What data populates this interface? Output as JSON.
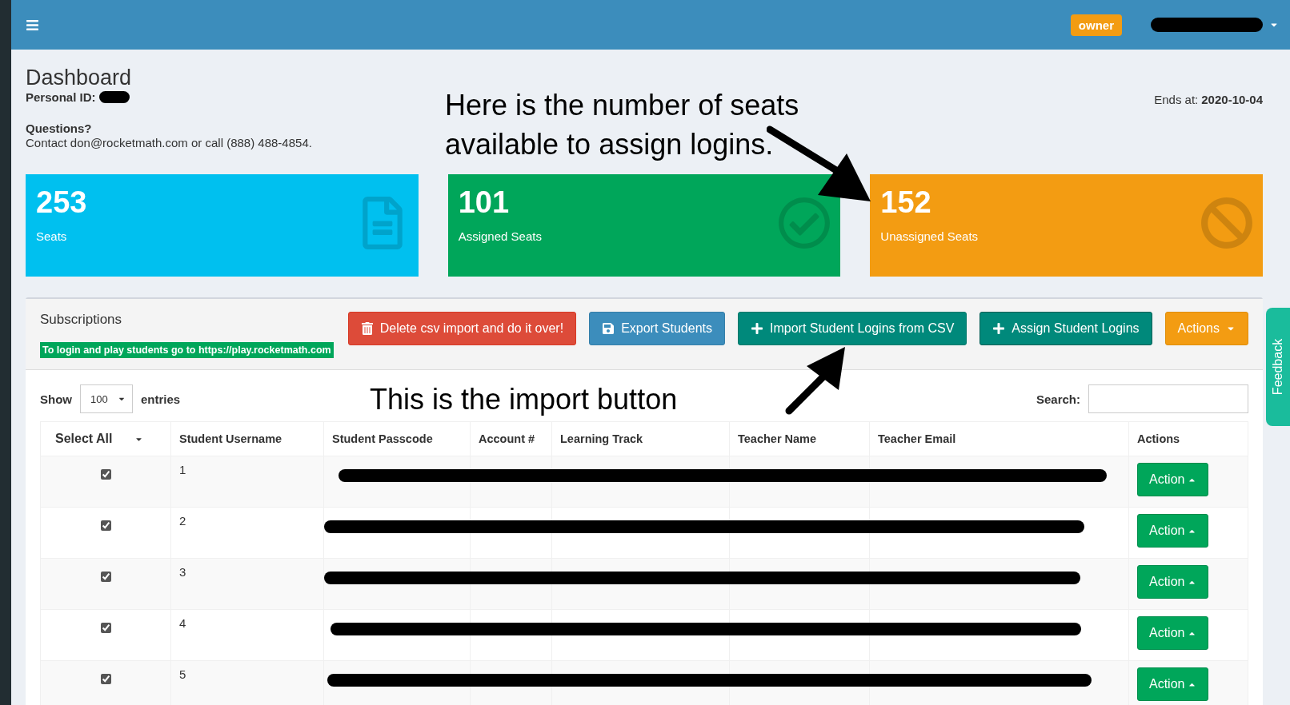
{
  "header": {
    "badge": "owner"
  },
  "page": {
    "title": "Dashboard",
    "personal_id_label": "Personal ID:",
    "questions_title": "Questions?",
    "contact": "Contact don@rocketmath.com or call (888) 488-4854.",
    "ends_label": "Ends at:",
    "ends_date": "2020-10-04"
  },
  "stats": [
    {
      "value": "253",
      "label": "Seats",
      "kind": "seats"
    },
    {
      "value": "101",
      "label": "Assigned Seats",
      "kind": "assigned"
    },
    {
      "value": "152",
      "label": "Unassigned Seats",
      "kind": "unassigned"
    }
  ],
  "subscriptions": {
    "title": "Subscriptions",
    "notice": "To login and play students go to https://play.rocketmath.com",
    "buttons": [
      {
        "label": "Delete csv import and do it over!",
        "kind": "delete"
      },
      {
        "label": "Export Students",
        "kind": "export"
      },
      {
        "label": "Import Student Logins from CSV",
        "kind": "import"
      },
      {
        "label": "Assign Student Logins",
        "kind": "assign"
      },
      {
        "label": "Actions",
        "kind": "dropdown"
      }
    ],
    "show_label": "Show",
    "page_size": "100",
    "entries_label": "entries",
    "search_label": "Search:"
  },
  "table": {
    "columns": [
      "Select All",
      "Student Username",
      "Student Passcode",
      "Account #",
      "Learning Track",
      "Teacher Name",
      "Teacher Email",
      "Actions"
    ],
    "rows": [
      {
        "username": "1",
        "checked": true,
        "action": "Action"
      },
      {
        "username": "2",
        "checked": true,
        "action": "Action"
      },
      {
        "username": "3",
        "checked": true,
        "action": "Action"
      },
      {
        "username": "4",
        "checked": true,
        "action": "Action"
      },
      {
        "username": "5",
        "checked": true,
        "action": "Action"
      }
    ]
  },
  "feedback": "Feedback",
  "annotations": [
    "Here is the number of seats available to assign logins.",
    "This is the import button"
  ]
}
